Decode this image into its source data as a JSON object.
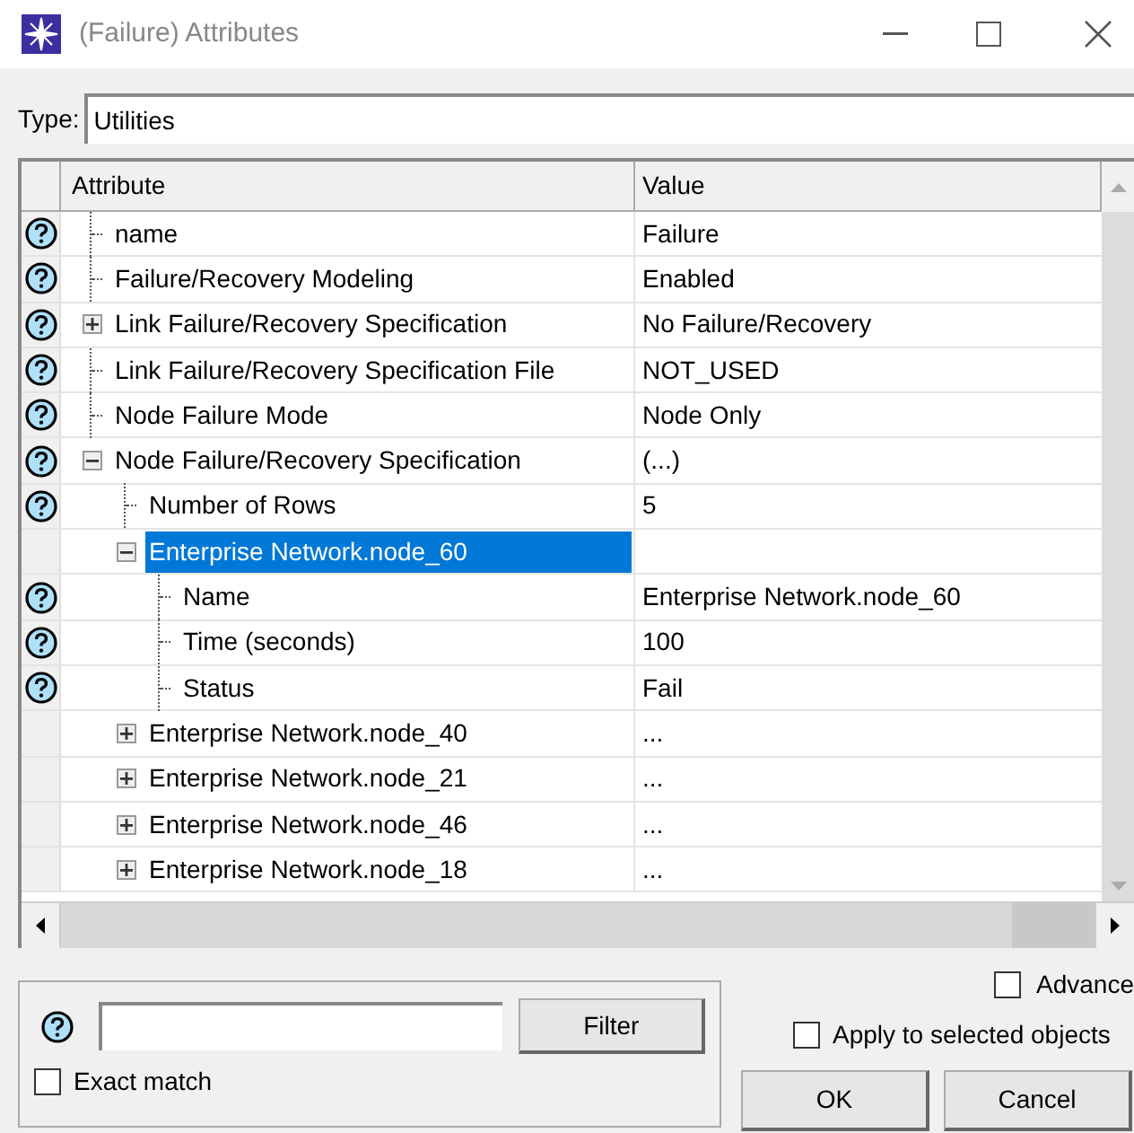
{
  "window": {
    "title": "(Failure) Attributes"
  },
  "type_field": {
    "label": "Type:",
    "value": "Utilities"
  },
  "table": {
    "columns": [
      "Attribute",
      "Value"
    ],
    "rows": [
      {
        "label": "name",
        "value": "Failure",
        "help": true,
        "selected": false
      },
      {
        "label": "Failure/Recovery Modeling",
        "value": "Enabled",
        "help": true,
        "selected": false
      },
      {
        "label": "Link Failure/Recovery Specification",
        "value": "No Failure/Recovery",
        "help": true,
        "selected": false,
        "expanded": false
      },
      {
        "label": "Link Failure/Recovery Specification File",
        "value": "NOT_USED",
        "help": true,
        "selected": false
      },
      {
        "label": "Node Failure Mode",
        "value": "Node Only",
        "help": true,
        "selected": false
      },
      {
        "label": "Node Failure/Recovery Specification",
        "value": "(...)",
        "help": true,
        "selected": false,
        "expanded": true,
        "children": [
          {
            "label": "Number of Rows",
            "value": "5",
            "help": true,
            "selected": false
          },
          {
            "label": "Enterprise Network.node_60",
            "help": false,
            "selected": true,
            "expanded": true,
            "children": [
              {
                "label": "Name",
                "value": "Enterprise Network.node_60",
                "help": true,
                "selected": false
              },
              {
                "label": "Time (seconds)",
                "value": "100",
                "help": true,
                "selected": false
              },
              {
                "label": "Status",
                "value": "Fail",
                "help": true,
                "selected": false
              }
            ]
          },
          {
            "label": "Enterprise Network.node_40",
            "value": "...",
            "help": false,
            "selected": false,
            "expanded": false
          },
          {
            "label": "Enterprise Network.node_21",
            "value": "...",
            "help": false,
            "selected": false,
            "expanded": false
          },
          {
            "label": "Enterprise Network.node_46",
            "value": "...",
            "help": false,
            "selected": false,
            "expanded": false
          },
          {
            "label": "Enterprise Network.node_18",
            "value": "...",
            "help": false,
            "selected": false,
            "expanded": false
          }
        ]
      }
    ]
  },
  "filter": {
    "button": "Filter",
    "exact_match": {
      "label": "Exact match",
      "checked": false
    }
  },
  "advanced": {
    "label": "Advance",
    "checked": false
  },
  "apply_to_selected": {
    "label": "Apply to selected objects",
    "checked": false
  },
  "buttons": [
    "OK",
    "Cancel"
  ]
}
